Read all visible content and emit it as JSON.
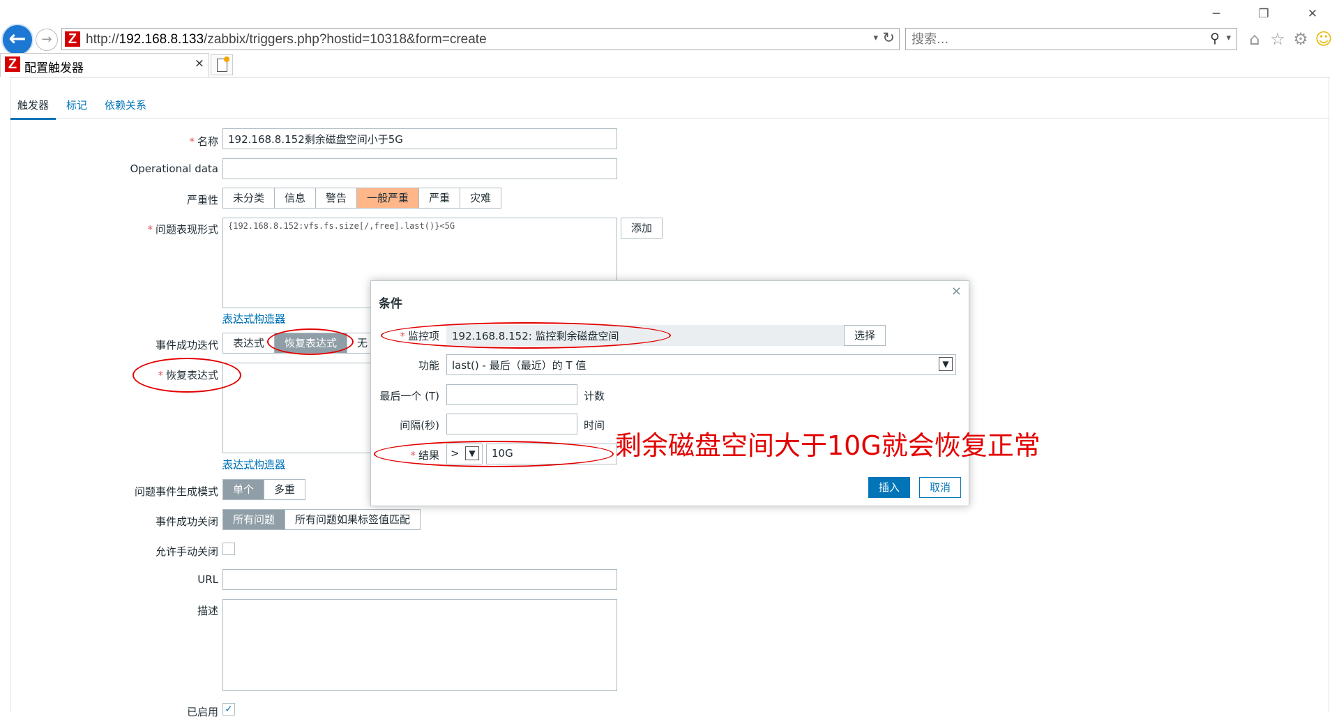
{
  "browser": {
    "url_prefix": "http://",
    "url_host": "192.168.8.133",
    "url_path": "/zabbix/triggers.php?hostid=10318&form=create",
    "search_placeholder": "搜索...",
    "tab_title": "配置触发器",
    "tab_close": "×",
    "logo_letter": "Z"
  },
  "form_tabs": [
    "触发器",
    "标记",
    "依赖关系"
  ],
  "form": {
    "name_label": "名称",
    "name_value": "192.168.8.152剩余磁盘空间小于5G",
    "opdata_label": "Operational data",
    "opdata_value": "",
    "severity_label": "严重性",
    "severity_options": [
      "未分类",
      "信息",
      "警告",
      "一般严重",
      "严重",
      "灾难"
    ],
    "severity_selected": "一般严重",
    "expression_label": "问题表现形式",
    "expression_value": "{192.168.8.152:vfs.fs.size[/,free].last()}<5G",
    "add_button": "添加",
    "expr_builder_link": "表达式构造器",
    "ok_event_gen_label": "事件成功迭代",
    "ok_event_gen_options": [
      "表达式",
      "恢复表达式",
      "无"
    ],
    "ok_event_gen_selected": "恢复表达式",
    "recovery_expr_label": "恢复表达式",
    "recovery_expr_value": "",
    "recovery_builder_link": "表达式构造器",
    "problem_mode_label": "问题事件生成模式",
    "problem_mode_options": [
      "单个",
      "多重"
    ],
    "problem_mode_selected": "单个",
    "ok_close_label": "事件成功关闭",
    "ok_close_options": [
      "所有问题",
      "所有问题如果标签值匹配"
    ],
    "ok_close_selected": "所有问题",
    "manual_close_label": "允许手动关闭",
    "url_label": "URL",
    "url_value": "",
    "desc_label": "描述",
    "desc_value": "",
    "enabled_label": "已启用"
  },
  "dialog": {
    "title": "条件",
    "close": "×",
    "item_label": "监控项",
    "item_value": "192.168.8.152: 监控剩余磁盘空间",
    "select_button": "选择",
    "function_label": "功能",
    "function_value": "last() - 最后（最近）的 T 值",
    "last_t_label": "最后一个 (T)",
    "last_t_value": "",
    "last_t_unit": "计数",
    "interval_label": "间隔(秒)",
    "interval_value": "",
    "interval_unit": "时间",
    "result_label": "结果",
    "result_operator": ">",
    "result_value": "10G",
    "insert_button": "插入",
    "cancel_button": "取消"
  },
  "annotation": {
    "text": "剩余磁盘空间大于10G就会恢复正常",
    "color": "#e30000"
  },
  "colors": {
    "link": "#0275b8",
    "severity_selected": "#ffb689",
    "segment_selected": "#8f9ea7",
    "primary_button": "#0275b8"
  }
}
